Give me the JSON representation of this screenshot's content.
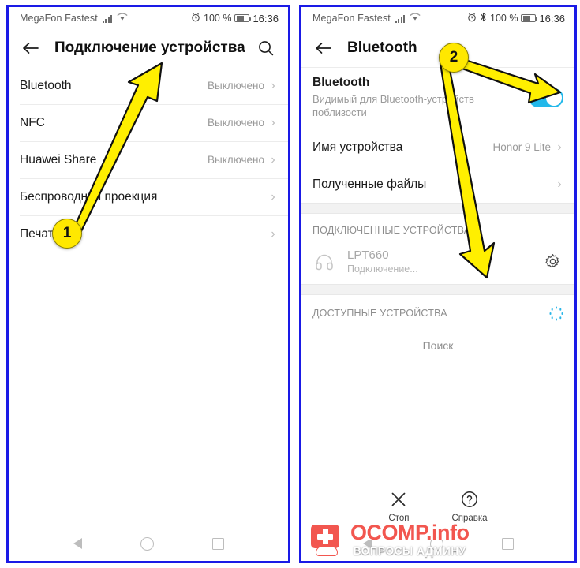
{
  "left_phone": {
    "status_bar": {
      "carrier": "MegaFon Fastest",
      "signal_icon": "signal-bars-icon",
      "wifi_icon": "wifi-icon",
      "alarm_icon": "alarm-clock-icon",
      "battery_percent": "100 %",
      "battery_icon": "battery-icon",
      "clock": "16:36"
    },
    "app_bar": {
      "back_icon": "back-arrow-icon",
      "title": "Подключение устройства",
      "search_icon": "search-icon"
    },
    "rows": [
      {
        "label": "Bluetooth",
        "value": "Выключено",
        "chevron": "›"
      },
      {
        "label": "NFC",
        "value": "Выключено",
        "chevron": "›"
      },
      {
        "label": "Huawei Share",
        "value": "Выключено",
        "chevron": "›"
      },
      {
        "label": "Беспроводная проекция",
        "value": "",
        "chevron": "›"
      },
      {
        "label": "Печать",
        "value": "",
        "chevron": "›"
      }
    ],
    "nav_bar": {
      "back_icon": "nav-back-icon",
      "home_icon": "nav-home-icon",
      "recents_icon": "nav-recents-icon"
    }
  },
  "right_phone": {
    "status_bar": {
      "carrier": "MegaFon Fastest",
      "signal_icon": "signal-bars-icon",
      "wifi_icon": "wifi-icon",
      "alarm_icon": "alarm-clock-icon",
      "bluetooth_icon": "bluetooth-icon",
      "battery_percent": "100 %",
      "battery_icon": "battery-icon",
      "clock": "16:36"
    },
    "app_bar": {
      "back_icon": "back-arrow-icon",
      "title": "Bluetooth"
    },
    "bluetooth_row": {
      "title": "Bluetooth",
      "subtitle": "Видимый для Bluetooth-устройств поблизости",
      "toggle_state": "on",
      "toggle_color": "#22b8ea"
    },
    "rows": [
      {
        "label": "Имя устройства",
        "value": "Honor 9 Lite",
        "chevron": "›"
      },
      {
        "label": "Полученные файлы",
        "value": "",
        "chevron": "›"
      }
    ],
    "paired_section": {
      "header": "ПОДКЛЮЧЕННЫЕ УСТРОЙСТВА",
      "device": {
        "icon": "headphones-icon",
        "name": "LPT660",
        "status": "Подключение...",
        "settings_icon": "gear-icon"
      }
    },
    "available_section": {
      "header": "ДОСТУПНЫЕ УСТРОЙСТВА",
      "spinner_icon": "loading-spinner-icon",
      "spinner_color": "#29b6e8",
      "search_text": "Поиск"
    },
    "action_bar": [
      {
        "icon": "close-x-icon",
        "label": "Стоп"
      },
      {
        "icon": "question-mark-icon",
        "label": "Справка"
      }
    ],
    "nav_bar": {
      "back_icon": "nav-back-icon",
      "home_icon": "nav-home-icon",
      "recents_icon": "nav-recents-icon"
    }
  },
  "annotations": {
    "marker_one": "1",
    "marker_two": "2",
    "arrow_color": "#ffef00",
    "badge_color": "#ffe800"
  },
  "watermark": {
    "main_text": "OCOMP.info",
    "sub_text": "ВОПРОСЫ АДМИНУ",
    "logo_icon": "first-aid-mouse-logo-icon",
    "brand_color": "#f2564f"
  }
}
